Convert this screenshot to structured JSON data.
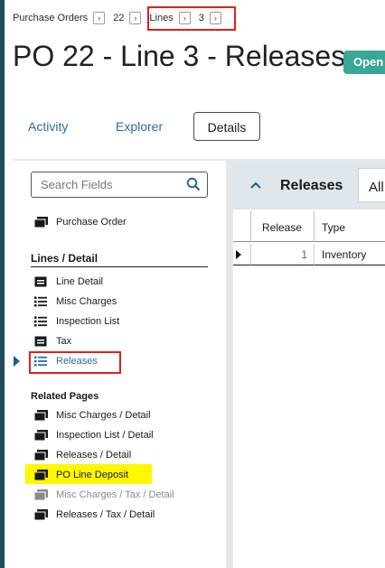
{
  "breadcrumb": {
    "items": [
      "Purchase Orders",
      "22",
      "Lines",
      "3"
    ],
    "arrow": "›"
  },
  "page": {
    "title": "PO 22 - Line 3 - Releases",
    "status": "Open"
  },
  "tabs": [
    {
      "label": "Activity"
    },
    {
      "label": "Explorer"
    },
    {
      "label": "Details"
    }
  ],
  "sidebar": {
    "search_placeholder": "Search Fields",
    "top_item": "Purchase Order",
    "section_title": "Lines / Detail",
    "section_items": [
      "Line Detail",
      "Misc Charges",
      "Inspection List",
      "Tax",
      "Releases"
    ],
    "related_title": "Related Pages",
    "related_items": [
      "Misc Charges / Detail",
      "Inspection List / Detail",
      "Releases / Detail",
      "PO Line Deposit",
      "Misc Charges / Tax / Detail",
      "Releases / Tax / Detail"
    ]
  },
  "grid": {
    "title": "Releases",
    "filter": "All",
    "columns": [
      "Release",
      "Type"
    ],
    "rows": [
      {
        "release": "1",
        "type": "Inventory"
      }
    ]
  },
  "colors": {
    "accent": "#2a6fa0",
    "status": "#3aa796",
    "highlight_box": "#e0211b",
    "highlight_fill": "#fff700"
  }
}
